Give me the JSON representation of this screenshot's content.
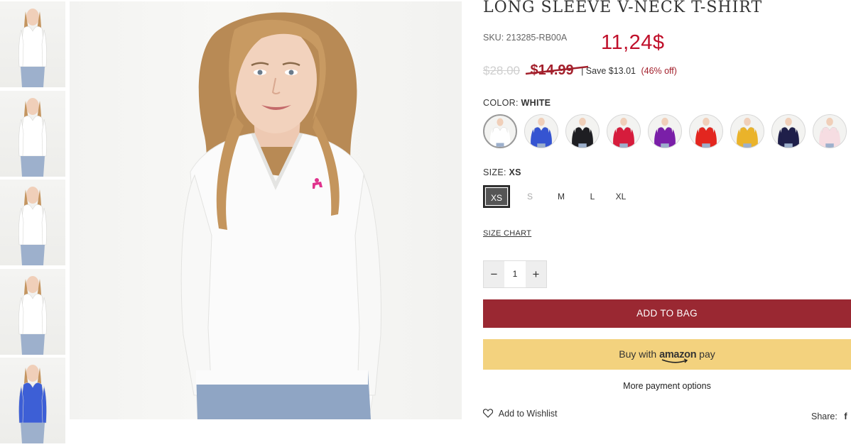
{
  "gallery": {
    "thumbnails": [
      {
        "name": "front-view",
        "shirt_color": "#ffffff"
      },
      {
        "name": "full-body-view",
        "shirt_color": "#ffffff"
      },
      {
        "name": "back-view",
        "shirt_color": "#ffffff"
      },
      {
        "name": "collar-detail-view",
        "shirt_color": "#ffffff"
      },
      {
        "name": "blue-variant-view",
        "shirt_color": "#3d5fd6"
      }
    ],
    "main_image": "model-wearing-white-v-neck"
  },
  "product": {
    "title": "LONG SLEEVE V-NECK T-SHIRT",
    "sku_label": "SKU:",
    "sku": "213285-RB00A",
    "annotated_price": "11,24$",
    "original_price": "$28.00",
    "sale_price": "$14.99",
    "save_text": "| Save $13.01",
    "save_percent": "(46% off)"
  },
  "color": {
    "label": "COLOR:",
    "selected": "WHITE",
    "swatches": [
      {
        "name": "white",
        "hex": "#ffffff"
      },
      {
        "name": "royal-blue",
        "hex": "#3554d1"
      },
      {
        "name": "black",
        "hex": "#1e1e22"
      },
      {
        "name": "red",
        "hex": "#d61c3c"
      },
      {
        "name": "purple",
        "hex": "#7a1fa8"
      },
      {
        "name": "orange-red",
        "hex": "#e3261f"
      },
      {
        "name": "yellow",
        "hex": "#eab32a"
      },
      {
        "name": "navy",
        "hex": "#1f1f4a"
      },
      {
        "name": "light-pink",
        "hex": "#f6dde2"
      }
    ]
  },
  "size": {
    "label": "SIZE:",
    "selected": "XS",
    "options": [
      {
        "label": "XS",
        "state": "selected"
      },
      {
        "label": "S",
        "state": "disabled"
      },
      {
        "label": "M",
        "state": "available"
      },
      {
        "label": "L",
        "state": "available"
      },
      {
        "label": "XL",
        "state": "available"
      }
    ],
    "chart_link": "SIZE CHART"
  },
  "quantity": {
    "minus": "−",
    "value": "1",
    "plus": "+"
  },
  "actions": {
    "add_to_bag": "ADD TO BAG",
    "amazon_pre": "Buy with",
    "amazon_brand": "amazon",
    "amazon_post": "pay",
    "more_payment": "More payment options",
    "wishlist": "Add to Wishlist",
    "share": "Share:",
    "share_icon": "f"
  },
  "colors": {
    "brand": "#9a2832",
    "price_red": "#c0102b",
    "amazon_yellow": "#f3d27e"
  }
}
